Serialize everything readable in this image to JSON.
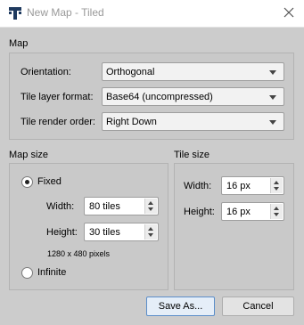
{
  "window": {
    "title": "New Map - Tiled",
    "app_icon": "tiled-logo-icon",
    "close_icon": "close-icon"
  },
  "map_section": {
    "label": "Map",
    "orientation": {
      "label": "Orientation:",
      "value": "Orthogonal"
    },
    "tile_layer_format": {
      "label": "Tile layer format:",
      "value": "Base64 (uncompressed)"
    },
    "tile_render_order": {
      "label": "Tile render order:",
      "value": "Right Down"
    }
  },
  "map_size": {
    "label": "Map size",
    "fixed": {
      "label": "Fixed",
      "checked": true
    },
    "width": {
      "label": "Width:",
      "value": "80 tiles"
    },
    "height": {
      "label": "Height:",
      "value": "30 tiles"
    },
    "pixels_text": "1280 x 480 pixels",
    "infinite": {
      "label": "Infinite",
      "checked": false
    }
  },
  "tile_size": {
    "label": "Tile size",
    "width": {
      "label": "Width:",
      "value": "16 px"
    },
    "height": {
      "label": "Height:",
      "value": "16 px"
    }
  },
  "buttons": {
    "save_as": "Save As...",
    "cancel": "Cancel"
  },
  "colors": {
    "dialog_bg": "#cccccc",
    "titlebar_bg": "#ffffff",
    "default_button_border": "#5c8ec9"
  }
}
